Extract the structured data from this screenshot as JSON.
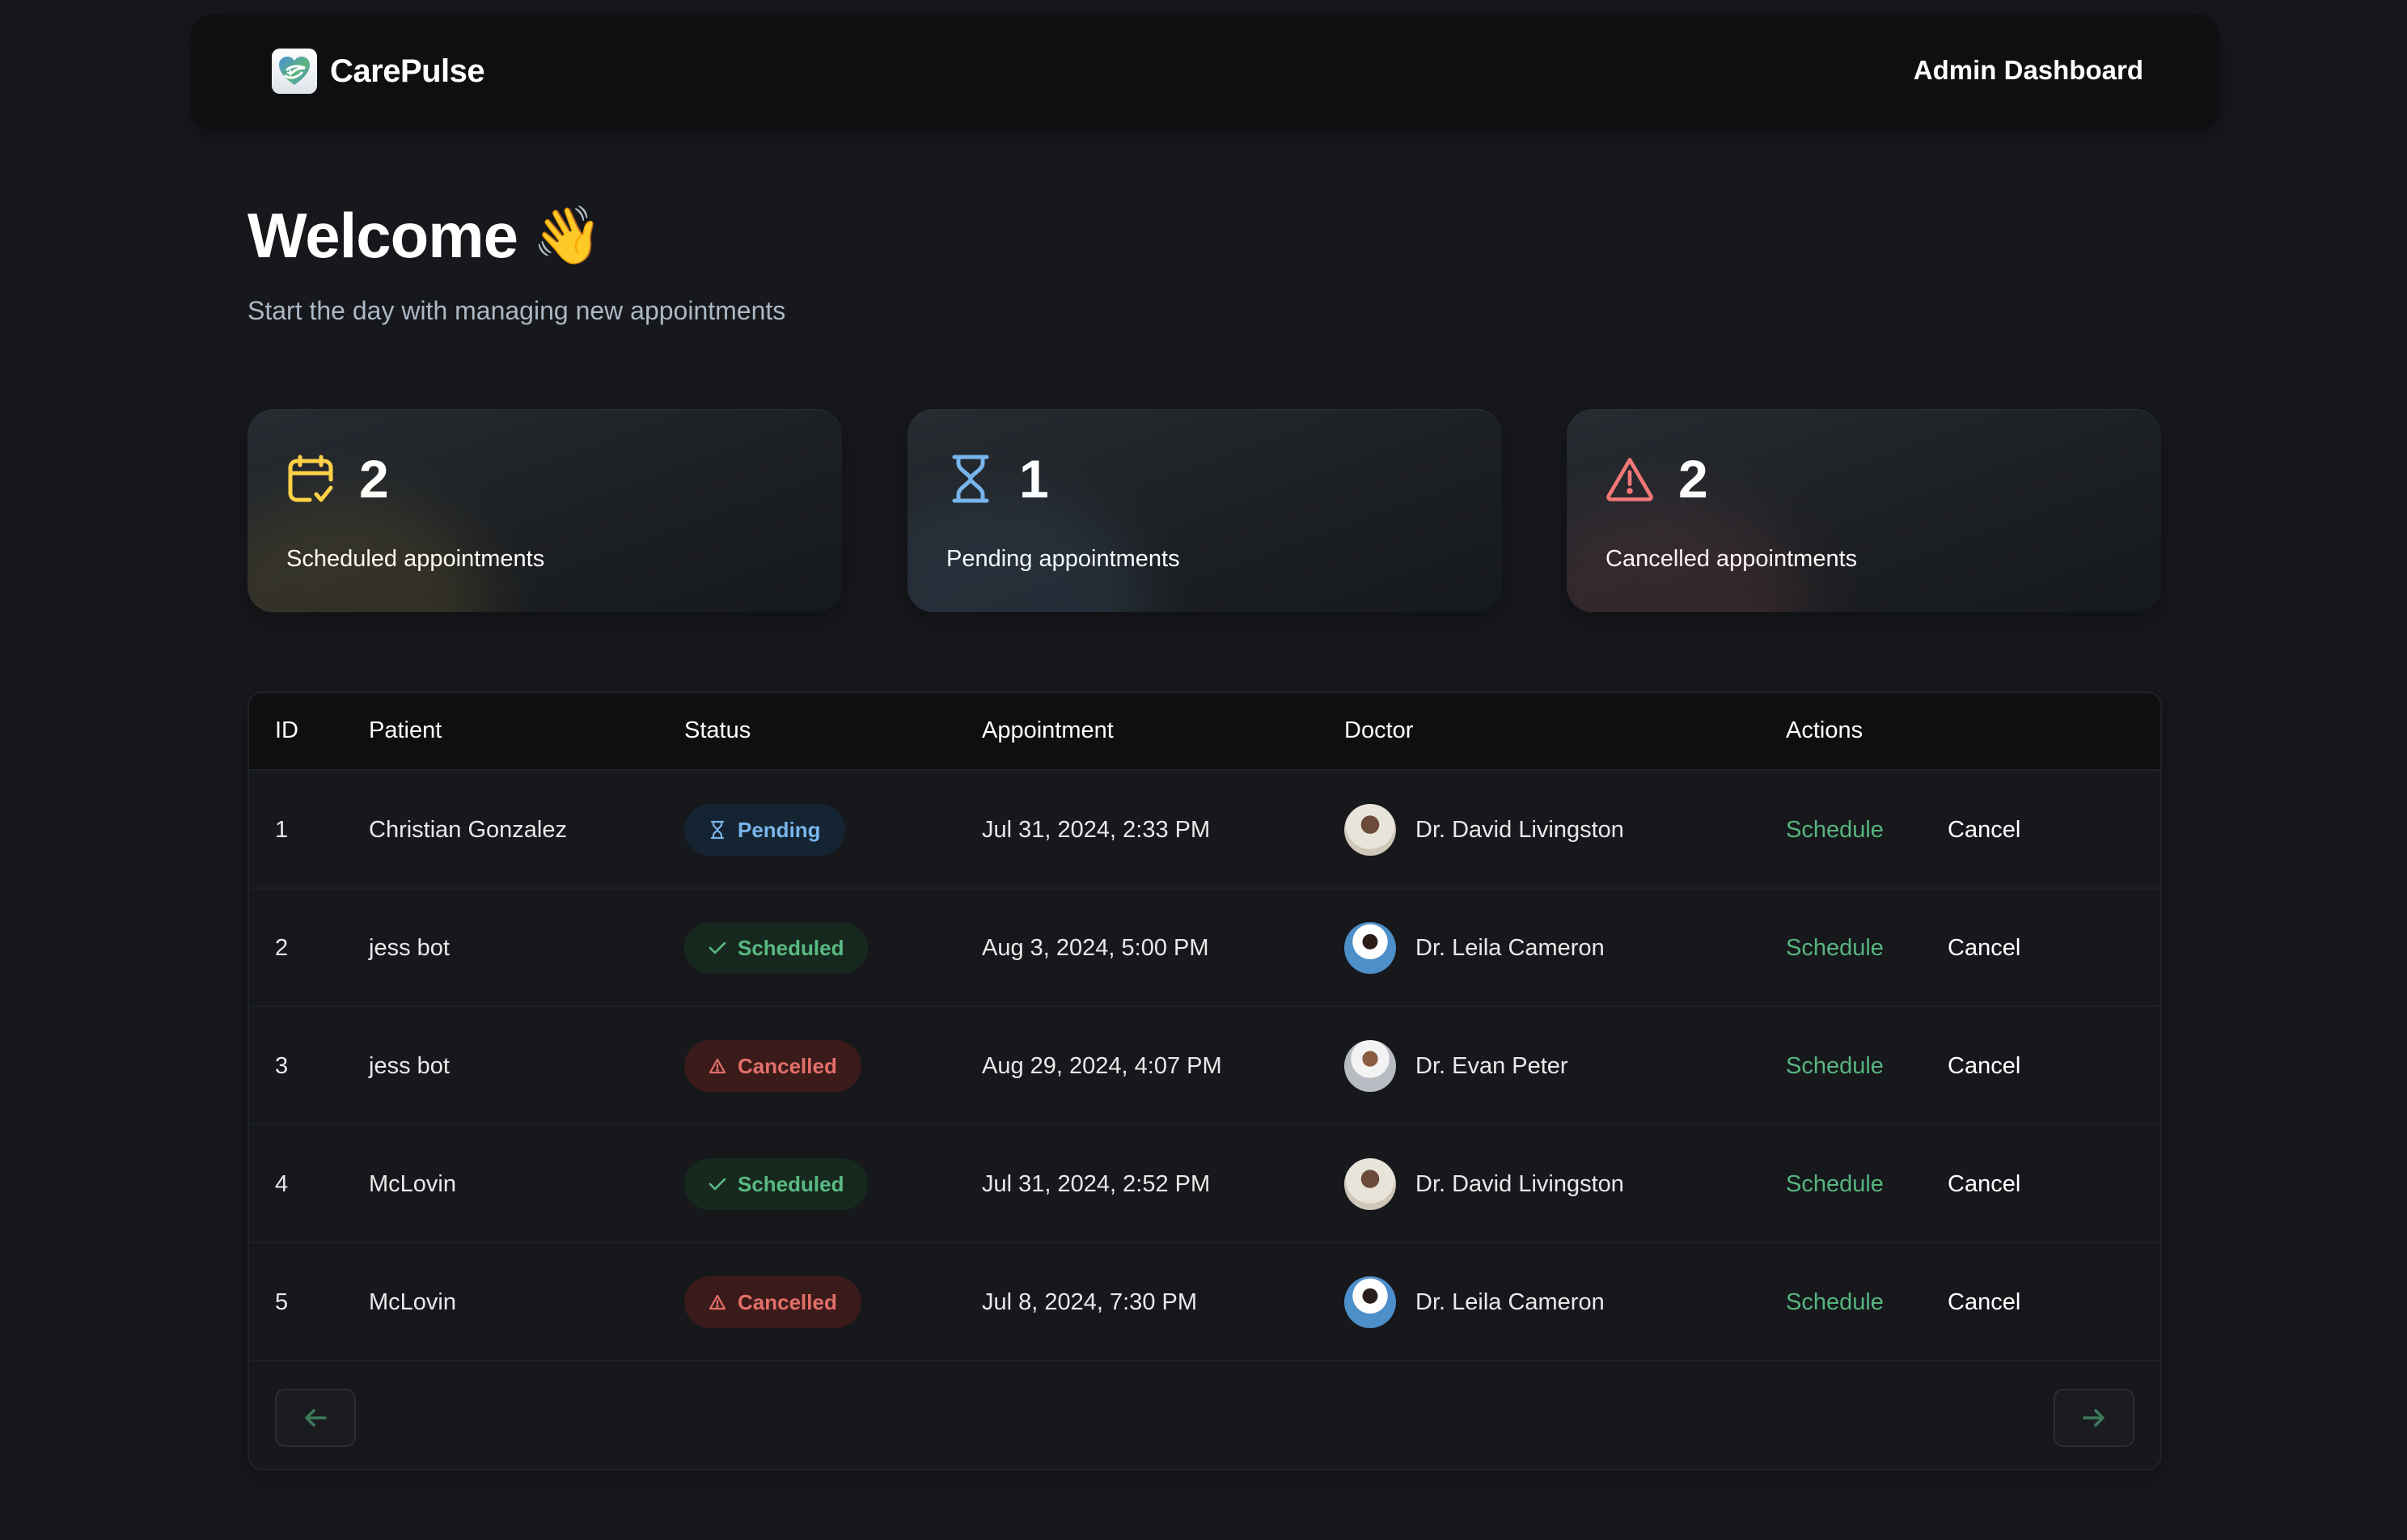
{
  "header": {
    "brand": "CarePulse",
    "title": "Admin Dashboard"
  },
  "welcome": {
    "title": "Welcome",
    "emoji": "👋",
    "subtitle": "Start the day with managing new appointments"
  },
  "stats": [
    {
      "key": "scheduled",
      "icon": "calendar-check-icon",
      "count": "2",
      "label": "Scheduled appointments",
      "color": "#FFD147"
    },
    {
      "key": "pending",
      "icon": "hourglass-icon",
      "count": "1",
      "label": "Pending appointments",
      "color": "#79B5EC"
    },
    {
      "key": "cancelled",
      "icon": "alert-triangle-icon",
      "count": "2",
      "label": "Cancelled appointments",
      "color": "#F37877"
    }
  ],
  "table": {
    "columns": [
      "ID",
      "Patient",
      "Status",
      "Appointment",
      "Doctor",
      "Actions"
    ],
    "rows": [
      {
        "id": "1",
        "patient": "Christian Gonzalez",
        "status": "Pending",
        "status_key": "pending",
        "appointment": "Jul 31, 2024, 2:33 PM",
        "doctor": "Dr. David Livingston",
        "avatar": "david"
      },
      {
        "id": "2",
        "patient": "jess bot",
        "status": "Scheduled",
        "status_key": "scheduled",
        "appointment": "Aug 3, 2024, 5:00 PM",
        "doctor": "Dr. Leila Cameron",
        "avatar": "leila"
      },
      {
        "id": "3",
        "patient": "jess bot",
        "status": "Cancelled",
        "status_key": "cancelled",
        "appointment": "Aug 29, 2024, 4:07 PM",
        "doctor": "Dr. Evan Peter",
        "avatar": "evan"
      },
      {
        "id": "4",
        "patient": "McLovin",
        "status": "Scheduled",
        "status_key": "scheduled",
        "appointment": "Jul 31, 2024, 2:52 PM",
        "doctor": "Dr. David Livingston",
        "avatar": "david"
      },
      {
        "id": "5",
        "patient": "McLovin",
        "status": "Cancelled",
        "status_key": "cancelled",
        "appointment": "Jul 8, 2024, 7:30 PM",
        "doctor": "Dr. Leila Cameron",
        "avatar": "leila"
      }
    ],
    "actions": {
      "schedule": "Schedule",
      "cancel": "Cancel"
    }
  },
  "pagination": {
    "prev_icon": "arrow-left-icon",
    "next_icon": "arrow-right-icon"
  },
  "colors": {
    "background": "#16181C",
    "header_bg": "#0D0F10",
    "accent_green": "#4AC97E",
    "pending_blue": "#79B5EC",
    "scheduled_yellow": "#FFD147",
    "cancelled_red": "#F37877",
    "subtitle_gray": "#ABB8C4"
  }
}
